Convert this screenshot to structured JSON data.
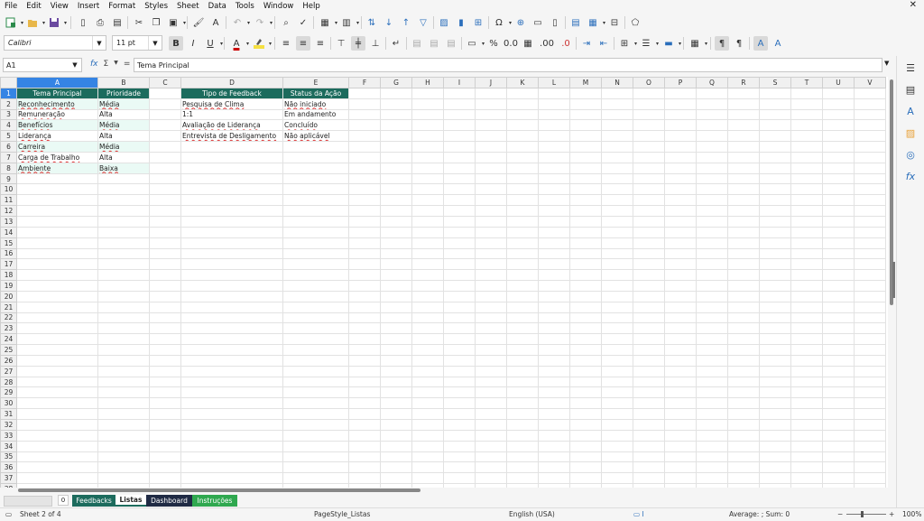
{
  "menu": [
    "File",
    "Edit",
    "View",
    "Insert",
    "Format",
    "Styles",
    "Sheet",
    "Data",
    "Tools",
    "Window",
    "Help"
  ],
  "menu_close": "✕",
  "font": {
    "name": "Calibri",
    "size": "11 pt"
  },
  "cell_ref": "A1",
  "formula": {
    "fx": "fx",
    "sigma": "Σ",
    "eq": "=",
    "content": "Tema Principal"
  },
  "columns": [
    "A",
    "B",
    "C",
    "D",
    "E",
    "F",
    "G",
    "H",
    "I",
    "J",
    "K",
    "L",
    "M",
    "N",
    "O",
    "P",
    "Q",
    "R",
    "S",
    "T",
    "U",
    "V"
  ],
  "rows": [
    [
      "Tema Principal",
      "Prioridade",
      "",
      "Tipo de Feedback",
      "Status da Ação"
    ],
    [
      "Reconhecimento",
      "Média",
      "",
      "Pesquisa de Clima",
      "Não iniciado"
    ],
    [
      "Remuneração",
      "Alta",
      "",
      "1:1",
      "Em andamento"
    ],
    [
      "Benefícios",
      "Média",
      "",
      "Avaliação de Liderança",
      "Concluído"
    ],
    [
      "Liderança",
      "Alta",
      "",
      "Entrevista de Desligamento",
      "Não aplicável"
    ],
    [
      "Carreira",
      "Média",
      "",
      "",
      ""
    ],
    [
      "Carga de Trabalho",
      "Alta",
      "",
      "",
      ""
    ],
    [
      "Ambiente",
      "Baixa",
      "",
      "",
      ""
    ]
  ],
  "row_count": 38,
  "sheet_tabs": [
    {
      "label": "Feedbacks",
      "bg": "#1c6b5d",
      "fg": "#ffffff"
    },
    {
      "label": "Listas",
      "bg": "#ffffff",
      "fg": "#222222"
    },
    {
      "label": "Dashboard",
      "bg": "#1f2a44",
      "fg": "#ffffff"
    },
    {
      "label": "Instruções",
      "bg": "#2fa84f",
      "fg": "#ffffff"
    }
  ],
  "tab_count_label": "0",
  "status": {
    "sheet": "Sheet 2 of 4",
    "page_style": "PageStyle_Listas",
    "language": "English (USA)",
    "summary": "Average: ; Sum: 0",
    "zoom": "100%"
  },
  "colors": {
    "header_bg": "#1c6b5d",
    "selection": "#3584e4",
    "tint": "#eafaf5"
  }
}
